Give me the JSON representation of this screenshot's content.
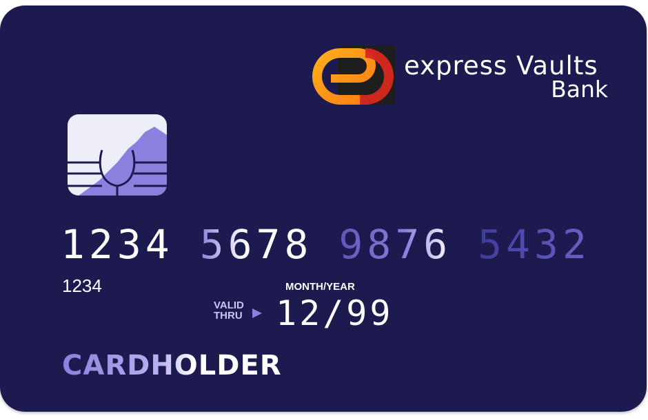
{
  "card": {
    "brand_line1": "express Vaults",
    "brand_line2": "Bank",
    "number_groups": [
      "1234",
      "5678",
      "9876",
      "5432"
    ],
    "sub_number": "1234",
    "month_year_label": "MONTH/YEAR",
    "valid_thru_label_line1": "VALID",
    "valid_thru_label_line2": "THRU",
    "expiry": "12/99",
    "cardholder": "CARDHOLDER"
  },
  "icons": {
    "logo": "bank-logo-icon",
    "chip": "chip-icon",
    "arrow": "arrow-right-icon"
  },
  "colors": {
    "card_background": "#1c1a4f",
    "accent_orange": "#ff9c1a",
    "accent_purple": "#8a80dd"
  }
}
